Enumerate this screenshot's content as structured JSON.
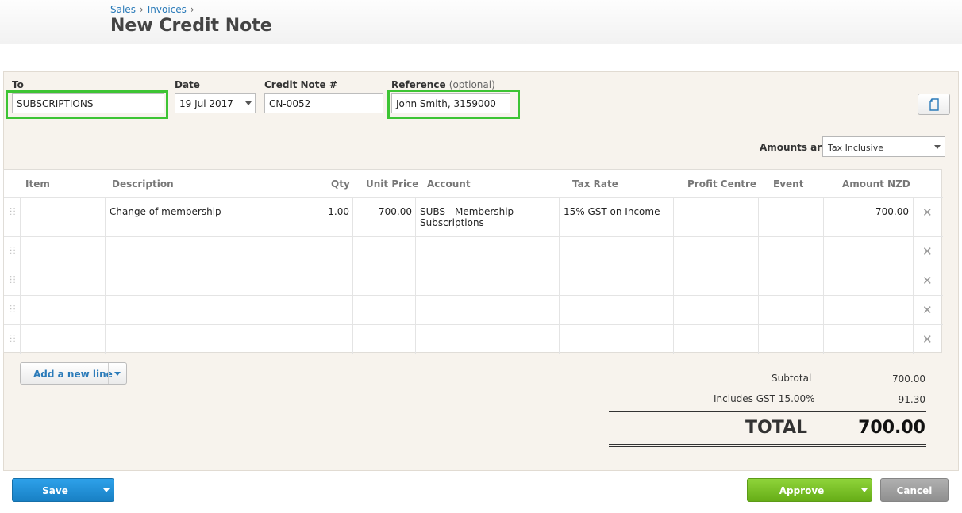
{
  "breadcrumb": {
    "sales": "Sales",
    "invoices": "Invoices",
    "sep": "›"
  },
  "page": {
    "title": "New Credit Note"
  },
  "form": {
    "to_label": "To",
    "to_value": "SUBSCRIPTIONS",
    "date_label": "Date",
    "date_value": "19 Jul 2017",
    "number_label": "Credit Note #",
    "number_value": "CN-0052",
    "reference_label": "Reference",
    "reference_optional": "(optional)",
    "reference_value": "John Smith, 3159000",
    "amounts_label": "Amounts are",
    "amounts_value": "Tax Inclusive"
  },
  "table": {
    "headers": [
      "Item",
      "Description",
      "Qty",
      "Unit Price",
      "Account",
      "Tax Rate",
      "Profit Centre",
      "Event",
      "Amount NZD"
    ],
    "rows": [
      {
        "item": "",
        "description": "Change of membership",
        "qty": "1.00",
        "unit_price": "700.00",
        "account_line1": "SUBS - Membership",
        "account_line2": "Subscriptions",
        "tax_rate": "15% GST on Income",
        "profit_centre": "",
        "event": "",
        "amount": "700.00"
      },
      {
        "item": "",
        "description": "",
        "qty": "",
        "unit_price": "",
        "account_line1": "",
        "account_line2": "",
        "tax_rate": "",
        "profit_centre": "",
        "event": "",
        "amount": ""
      },
      {
        "item": "",
        "description": "",
        "qty": "",
        "unit_price": "",
        "account_line1": "",
        "account_line2": "",
        "tax_rate": "",
        "profit_centre": "",
        "event": "",
        "amount": ""
      },
      {
        "item": "",
        "description": "",
        "qty": "",
        "unit_price": "",
        "account_line1": "",
        "account_line2": "",
        "tax_rate": "",
        "profit_centre": "",
        "event": "",
        "amount": ""
      },
      {
        "item": "",
        "description": "",
        "qty": "",
        "unit_price": "",
        "account_line1": "",
        "account_line2": "",
        "tax_rate": "",
        "profit_centre": "",
        "event": "",
        "amount": ""
      }
    ],
    "delete_glyph": "✕"
  },
  "actions": {
    "add_line": "Add a new line",
    "save": "Save",
    "approve": "Approve",
    "cancel": "Cancel"
  },
  "totals": {
    "subtotal_label": "Subtotal",
    "subtotal_value": "700.00",
    "gst_label": "Includes GST 15.00%",
    "gst_value": "91.30",
    "total_label": "TOTAL",
    "total_value": "700.00"
  },
  "colors": {
    "highlight": "#3dc434",
    "link": "#2b7bb9",
    "save": "#1f8fd6",
    "approve": "#7ac324",
    "cancel": "#9a9a9a"
  },
  "icons": {
    "document": "document-icon",
    "drag": "drag-handle-icon",
    "delete": "delete-icon",
    "dropdown": "chevron-down-icon"
  }
}
